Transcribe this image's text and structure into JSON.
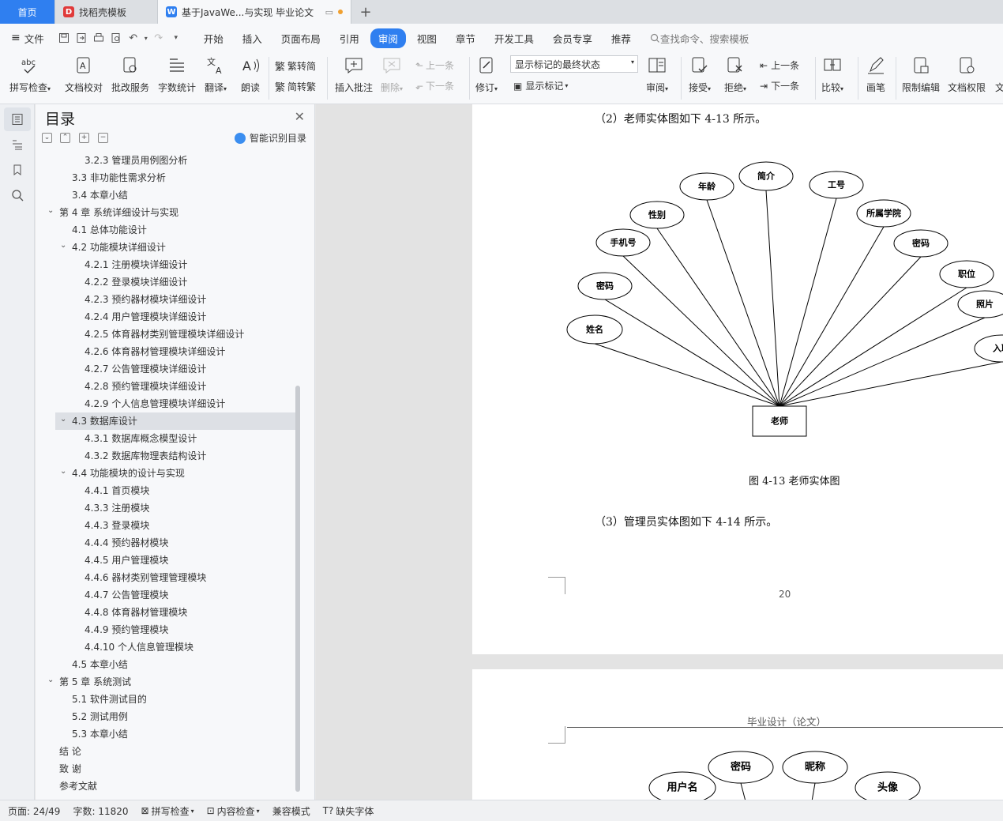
{
  "tabs": [
    {
      "label": "首页",
      "icon": "wps-home"
    },
    {
      "label": "找稻壳模板",
      "icon": "docer-icon"
    },
    {
      "label": "基于JavaWe...与实现 毕业论文",
      "icon": "word-doc-icon"
    }
  ],
  "menubar": {
    "file": "文件",
    "items": [
      "开始",
      "插入",
      "页面布局",
      "引用",
      "审阅",
      "视图",
      "章节",
      "开发工具",
      "会员专享",
      "推荐"
    ],
    "active": "审阅",
    "search": "查找命令、搜索模板"
  },
  "ribbon": {
    "spell": "拼写检查",
    "proof": "文档校对",
    "correct": "批改服务",
    "wordcount": "字数统计",
    "translate": "翻译",
    "read": "朗读",
    "trad": "繁转简",
    "simp": "简转繁",
    "add_comment": "插入批注",
    "delete": "删除",
    "prev1": "上一条",
    "next1": "下一条",
    "revise": "修订",
    "markup_state": "显示标记的最终状态",
    "show_markup": "显示标记",
    "review": "审阅",
    "accept": "接受",
    "reject": "拒绝",
    "prev2": "上一条",
    "next2": "下一条",
    "compare": "比较",
    "pen": "画笔",
    "restrict": "限制编辑",
    "permission": "文档权限",
    "more": "文"
  },
  "toc": {
    "title": "目录",
    "smart": "智能识别目录",
    "items": [
      {
        "text": "3.2.3  管理员用例图分析",
        "level": 3
      },
      {
        "text": "3.3  非功能性需求分析",
        "level": 2
      },
      {
        "text": "3.4  本章小结",
        "level": 2
      },
      {
        "text": "第 4 章  系统详细设计与实现",
        "level": 1,
        "expanded": true
      },
      {
        "text": "4.1  总体功能设计",
        "level": 2
      },
      {
        "text": "4.2 功能模块详细设计",
        "level": 2,
        "expanded": true
      },
      {
        "text": "4.2.1 注册模块详细设计",
        "level": 3
      },
      {
        "text": "4.2.2 登录模块详细设计",
        "level": 3
      },
      {
        "text": "4.2.3 预约器材模块详细设计",
        "level": 3
      },
      {
        "text": "4.2.4 用户管理模块详细设计",
        "level": 3
      },
      {
        "text": "4.2.5 体育器材类别管理模块详细设计",
        "level": 3
      },
      {
        "text": "4.2.6 体育器材管理模块详细设计",
        "level": 3
      },
      {
        "text": "4.2.7 公告管理模块详细设计",
        "level": 3
      },
      {
        "text": "4.2.8 预约管理模块详细设计",
        "level": 3
      },
      {
        "text": "4.2.9 个人信息管理模块详细设计",
        "level": 3
      },
      {
        "text": "4.3 数据库设计",
        "level": 2,
        "expanded": true,
        "active": true
      },
      {
        "text": "4.3.1 数据库概念模型设计",
        "level": 3
      },
      {
        "text": "4.3.2 数据库物理表结构设计",
        "level": 3
      },
      {
        "text": "4.4  功能模块的设计与实现",
        "level": 2,
        "expanded": true
      },
      {
        "text": "4.4.1  首页模块",
        "level": 3
      },
      {
        "text": "4.3.3 注册模块",
        "level": 3
      },
      {
        "text": "4.4.3 登录模块",
        "level": 3
      },
      {
        "text": "4.4.4 预约器材模块",
        "level": 3
      },
      {
        "text": "4.4.5 用户管理模块",
        "level": 3
      },
      {
        "text": "4.4.6 器材类别管理管理模块",
        "level": 3
      },
      {
        "text": "4.4.7 公告管理模块",
        "level": 3
      },
      {
        "text": "4.4.8 体育器材管理模块",
        "level": 3
      },
      {
        "text": "4.4.9 预约管理模块",
        "level": 3
      },
      {
        "text": "4.4.10  个人信息管理模块",
        "level": 3
      },
      {
        "text": "4.5  本章小结",
        "level": 2
      },
      {
        "text": "第 5 章  系统测试",
        "level": 1,
        "expanded": true
      },
      {
        "text": "5.1  软件测试目的",
        "level": 2
      },
      {
        "text": "5.2  测试用例",
        "level": 2
      },
      {
        "text": "5.3  本章小结",
        "level": 2
      },
      {
        "text": "结  论",
        "level": 1
      },
      {
        "text": "致  谢",
        "level": 1
      },
      {
        "text": "参考文献",
        "level": 1
      }
    ]
  },
  "doc": {
    "para1": "（2）老师实体图如下 4-13 所示。",
    "caption": "图 4-13  老师实体图",
    "para2": "（3）管理员实体图如下 4-14 所示。",
    "page_number": "20",
    "header2": "毕业设计（论文）",
    "er1": {
      "entity": "老师",
      "attributes": [
        "姓名",
        "密码",
        "手机号",
        "性别",
        "年龄",
        "简介",
        "工号",
        "所属学院",
        "密码",
        "职位",
        "照片",
        "入职"
      ]
    },
    "er2": {
      "attributes": [
        "用户名",
        "密码",
        "昵称",
        "头像"
      ]
    }
  },
  "status": {
    "page": "页面: 24/49",
    "words": "字数: 11820",
    "spell": "拼写检查",
    "content": "内容检查",
    "compat": "兼容模式",
    "font": "缺失字体"
  }
}
